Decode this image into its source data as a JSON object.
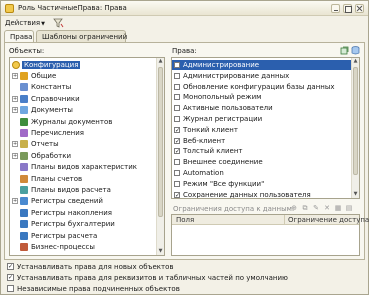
{
  "window": {
    "title": "Роль ЧастичныеПрава: Права"
  },
  "toolbar": {
    "actions_label": "Действия"
  },
  "tabs": [
    {
      "label": "Права",
      "active": true
    },
    {
      "label": "Шаблоны ограничений",
      "active": false
    }
  ],
  "objects": {
    "label": "Объекты:",
    "root": "Конфигурация",
    "items": [
      {
        "label": "Общие",
        "expandable": true,
        "icon": "folder-icon",
        "color": "#e0a21f"
      },
      {
        "label": "Константы",
        "expandable": false,
        "icon": "constants-icon",
        "color": "#6a8fd0"
      },
      {
        "label": "Справочники",
        "expandable": true,
        "icon": "catalog-icon",
        "color": "#4a7fc8"
      },
      {
        "label": "Документы",
        "expandable": true,
        "icon": "document-icon",
        "color": "#6fa7e0"
      },
      {
        "label": "Журналы документов",
        "expandable": false,
        "icon": "journal-icon",
        "color": "#3e8d3e"
      },
      {
        "label": "Перечисления",
        "expandable": false,
        "icon": "enum-icon",
        "color": "#a06ac8"
      },
      {
        "label": "Отчеты",
        "expandable": true,
        "icon": "report-icon",
        "color": "#c8b04a"
      },
      {
        "label": "Обработки",
        "expandable": true,
        "icon": "gear-icon",
        "color": "#7a9a5a"
      },
      {
        "label": "Планы видов характеристик",
        "expandable": false,
        "icon": "chart-plan-icon",
        "color": "#8a78c8"
      },
      {
        "label": "Планы счетов",
        "expandable": false,
        "icon": "accounts-icon",
        "color": "#d08a3a"
      },
      {
        "label": "Планы видов расчета",
        "expandable": false,
        "icon": "calc-plan-icon",
        "color": "#4aa0a0"
      },
      {
        "label": "Регистры сведений",
        "expandable": true,
        "icon": "register-icon",
        "color": "#4a8ad0"
      },
      {
        "label": "Регистры накопления",
        "expandable": false,
        "icon": "accum-register-icon",
        "color": "#3a78c0"
      },
      {
        "label": "Регистры бухгалтерии",
        "expandable": false,
        "icon": "account-register-icon",
        "color": "#3a78c0"
      },
      {
        "label": "Регистры расчета",
        "expandable": false,
        "icon": "calc-register-icon",
        "color": "#3a78c0"
      },
      {
        "label": "Бизнес-процессы",
        "expandable": false,
        "icon": "process-icon",
        "color": "#c05a3a"
      }
    ]
  },
  "rights": {
    "label": "Права:",
    "items": [
      {
        "label": "Администрирование",
        "checked": false,
        "selected": true
      },
      {
        "label": "Администрирование данных",
        "checked": false,
        "selected": false
      },
      {
        "label": "Обновление конфигурации базы данных",
        "checked": false,
        "selected": false
      },
      {
        "label": "Монопольный режим",
        "checked": false,
        "selected": false
      },
      {
        "label": "Активные пользователи",
        "checked": false,
        "selected": false
      },
      {
        "label": "Журнал регистрации",
        "checked": false,
        "selected": false
      },
      {
        "label": "Тонкий клиент",
        "checked": true,
        "selected": false
      },
      {
        "label": "Веб-клиент",
        "checked": true,
        "selected": false
      },
      {
        "label": "Толстый клиент",
        "checked": true,
        "selected": false
      },
      {
        "label": "Внешнее соединение",
        "checked": false,
        "selected": false
      },
      {
        "label": "Automation",
        "checked": false,
        "selected": false
      },
      {
        "label": "Режим \"Все функции\"",
        "checked": false,
        "selected": false
      },
      {
        "label": "Сохранение данных пользователя",
        "checked": true,
        "selected": false
      }
    ]
  },
  "limits": {
    "label": "Ограничения доступа к данным:",
    "columns": [
      "Поля",
      "Ограничение доступа"
    ]
  },
  "options": [
    {
      "label": "Устанавливать права для новых объектов",
      "checked": true
    },
    {
      "label": "Устанавливать права для реквизитов и табличных частей по умолчанию",
      "checked": true
    },
    {
      "label": "Независимые права подчиненных объектов",
      "checked": false
    }
  ]
}
